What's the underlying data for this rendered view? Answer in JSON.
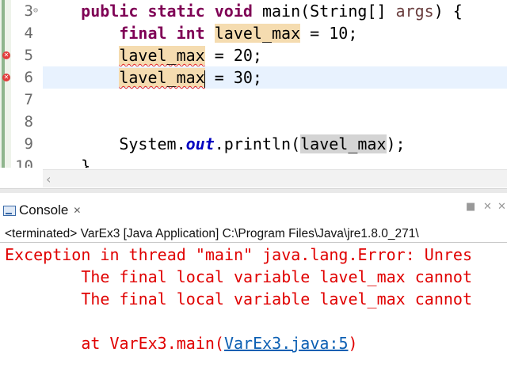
{
  "editor": {
    "lines": [
      {
        "num": "3",
        "fold": "⊖",
        "indent": "    ",
        "kw1": "public static void",
        "rest": " main(String[] ",
        "param": "args",
        "tail": ") {"
      },
      {
        "num": "4",
        "indent": "        ",
        "kw": "final int",
        "sp": " ",
        "var": "lavel_max",
        "tail": " = 10;"
      },
      {
        "num": "5",
        "indent": "        ",
        "var": "lavel_max",
        "tail": " = 20;"
      },
      {
        "num": "6",
        "indent": "        ",
        "var": "lavel_max",
        "tail": " = 30;"
      },
      {
        "num": "7"
      },
      {
        "num": "8"
      },
      {
        "num": "9",
        "indent": "        ",
        "pre": "System.",
        "field": "out",
        "mid": ".println(",
        "var": "lavel_max",
        "tail": ");"
      },
      {
        "num": "10",
        "indent": "    ",
        "tail": "}"
      }
    ]
  },
  "console": {
    "tab_label": "Console",
    "description": "<terminated> VarEx3 [Java Application] C:\\Program Files\\Java\\jre1.8.0_271\\",
    "output": [
      "Exception in thread \"main\" java.lang.Error: Unres",
      "        The final local variable lavel_max cannot",
      "        The final local variable lavel_max cannot",
      ""
    ],
    "stack_prefix": "        at VarEx3.main(",
    "stack_link": "VarEx3.java:5",
    "stack_suffix": ")"
  },
  "colors": {
    "keyword": "#7f0055",
    "error_text": "#e00000",
    "link": "#0b5fb3",
    "occurrence_highlight": "#f5dcb0"
  }
}
